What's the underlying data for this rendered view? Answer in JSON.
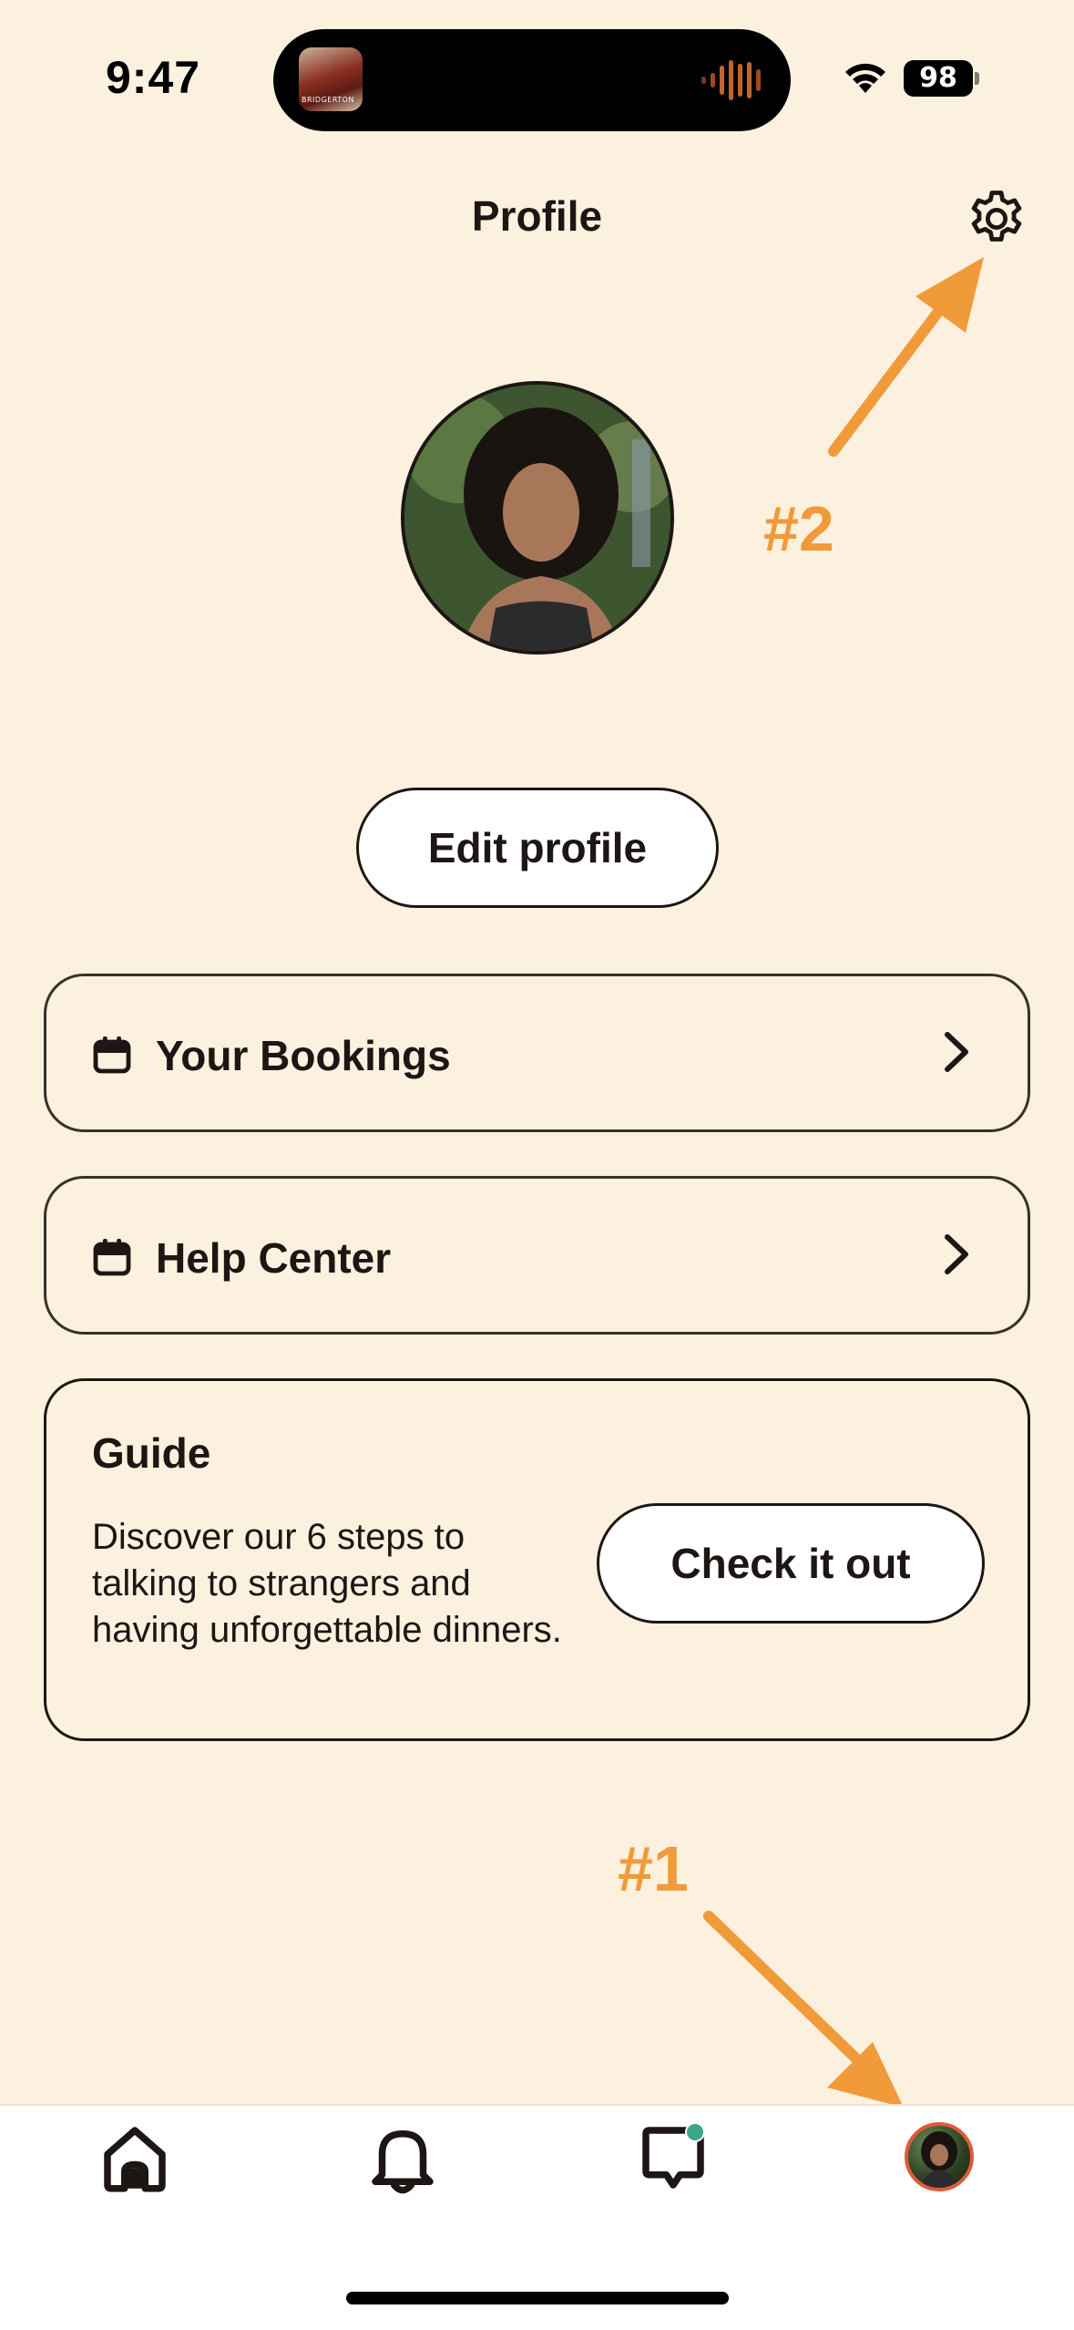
{
  "status_bar": {
    "time": "9:47",
    "battery": "98",
    "now_playing_art_text": "BRIDGERTON"
  },
  "header": {
    "title": "Profile",
    "settings_icon": "gear-icon"
  },
  "profile": {
    "edit_label": "Edit profile"
  },
  "menu": [
    {
      "label": "Your Bookings",
      "icon": "calendar-icon"
    },
    {
      "label": "Help Center",
      "icon": "calendar-icon"
    }
  ],
  "guide": {
    "title": "Guide",
    "description": "Discover our 6 steps to talking to strangers and having unforgettable dinners.",
    "button_label": "Check it out"
  },
  "annotations": {
    "first": "#1",
    "second": "#2"
  },
  "tab_bar": {
    "items": [
      "home-icon",
      "bell-icon",
      "chat-icon",
      "profile-avatar"
    ]
  },
  "colors": {
    "background": "#FCF1DF",
    "annotation": "#F19A3A",
    "chat_badge": "#3CA58A",
    "avatar_ring": "#E05A3A"
  }
}
